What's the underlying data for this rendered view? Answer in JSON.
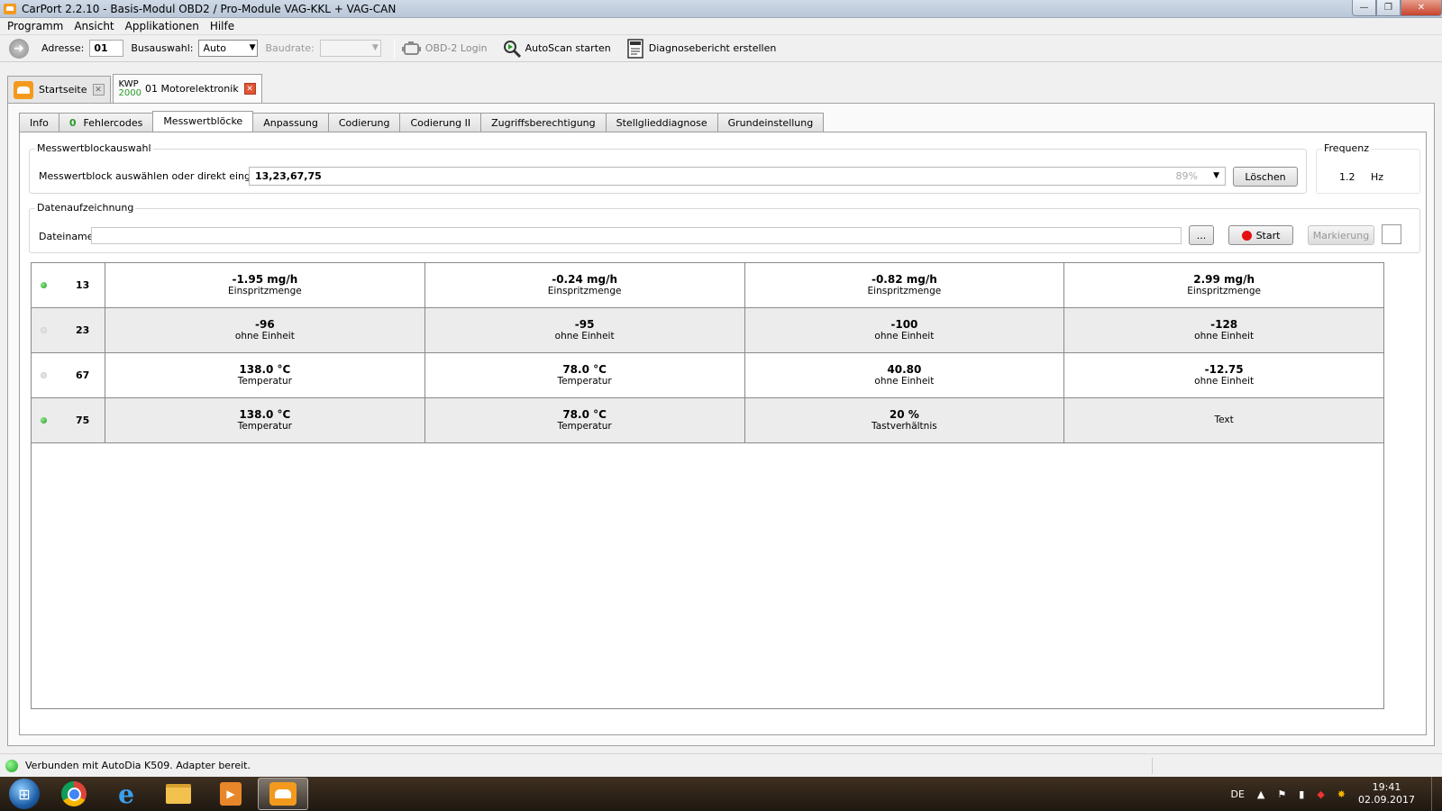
{
  "window": {
    "title": "CarPort 2.2.10  - Basis-Modul OBD2 / Pro-Module VAG-KKL + VAG-CAN",
    "controls": {
      "minimize": "—",
      "maximize": "❐",
      "close": "✕"
    }
  },
  "menu": [
    "Programm",
    "Ansicht",
    "Applikationen",
    "Hilfe"
  ],
  "toolbar": {
    "address_label": "Adresse:",
    "address_value": "01",
    "bus_label": "Busauswahl:",
    "bus_value": "Auto",
    "baud_label": "Baudrate:",
    "baud_value": "",
    "obd_login": "OBD-2 Login",
    "autoscan": "AutoScan starten",
    "report": "Diagnosebericht erstellen"
  },
  "doc_tabs": {
    "start": "Startseite",
    "kwp_top": "KWP",
    "kwp_bottom": "2000",
    "module": "01 Motorelektronik"
  },
  "inner_tabs": {
    "info": "Info",
    "fehler_count": "0",
    "fehler": "Fehlercodes",
    "mwb": "Messwertblöcke",
    "anpassung": "Anpassung",
    "codierung": "Codierung",
    "codierung2": "Codierung II",
    "zugriff": "Zugriffsberechtigung",
    "stellglied": "Stellglieddiagnose",
    "grund": "Grundeinstellung"
  },
  "mwb_selection": {
    "group_title": "Messwertblockauswahl",
    "label": "Messwertblock auswählen oder direkt eingeben:",
    "value": "13,23,67,75",
    "percent": "89%",
    "clear": "Löschen"
  },
  "frequency": {
    "title": "Frequenz",
    "value": "1.2",
    "unit": "Hz"
  },
  "recording": {
    "group_title": "Datenaufzeichnung",
    "filename_label": "Dateiname",
    "filename_value": "",
    "browse": "...",
    "start": "Start",
    "mark": "Markierung"
  },
  "blocks": [
    {
      "number": "13",
      "led": "green",
      "values": [
        {
          "value": "-1.95 mg/h",
          "unit": "Einspritzmenge"
        },
        {
          "value": "-0.24 mg/h",
          "unit": "Einspritzmenge"
        },
        {
          "value": "-0.82 mg/h",
          "unit": "Einspritzmenge"
        },
        {
          "value": "2.99 mg/h",
          "unit": "Einspritzmenge"
        }
      ]
    },
    {
      "number": "23",
      "led": "grey",
      "values": [
        {
          "value": "-96",
          "unit": "ohne Einheit"
        },
        {
          "value": "-95",
          "unit": "ohne Einheit"
        },
        {
          "value": "-100",
          "unit": "ohne Einheit"
        },
        {
          "value": "-128",
          "unit": "ohne Einheit"
        }
      ]
    },
    {
      "number": "67",
      "led": "grey",
      "values": [
        {
          "value": "138.0 °C",
          "unit": "Temperatur"
        },
        {
          "value": "78.0 °C",
          "unit": "Temperatur"
        },
        {
          "value": "40.80",
          "unit": "ohne Einheit"
        },
        {
          "value": "-12.75",
          "unit": "ohne Einheit"
        }
      ]
    },
    {
      "number": "75",
      "led": "green",
      "values": [
        {
          "value": "138.0 °C",
          "unit": "Temperatur"
        },
        {
          "value": "78.0 °C",
          "unit": "Temperatur"
        },
        {
          "value": "20 %",
          "unit": "Tastverhältnis"
        },
        {
          "value": "",
          "unit": "Text"
        }
      ]
    }
  ],
  "status": {
    "text": "Verbunden mit AutoDia K509. Adapter bereit.",
    "led_color": "#18a618"
  },
  "taskbar": {
    "apps": [
      "chrome-icon",
      "internet-explorer-icon",
      "folder-icon",
      "media-player-icon",
      "carport-icon"
    ],
    "language": "DE",
    "time": "19:41",
    "date": "02.09.2017"
  },
  "colors": {
    "accent_orange": "#f39a1e",
    "led_green": "#1f9a1f",
    "record_red": "#e51010",
    "close_red": "#e05535"
  }
}
